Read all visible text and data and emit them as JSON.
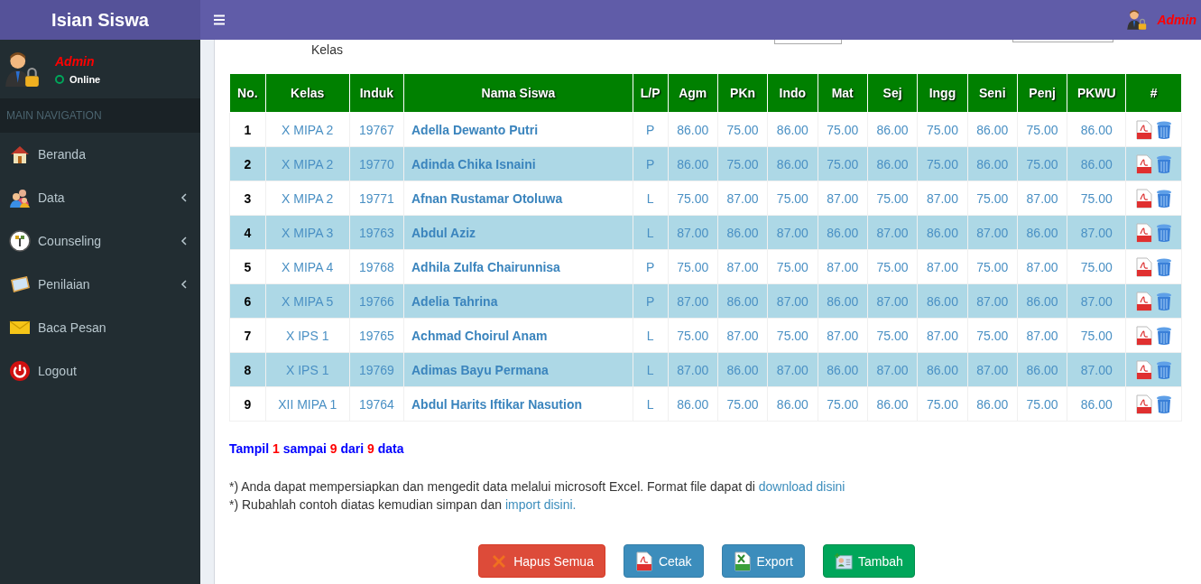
{
  "brand": "Isian Siswa",
  "topbar": {
    "user": "Admin"
  },
  "sidebar": {
    "user": {
      "name": "Admin",
      "status": "Online"
    },
    "header": "MAIN NAVIGATION",
    "items": [
      {
        "label": "Beranda",
        "kind": "house",
        "expandable": false
      },
      {
        "label": "Data",
        "kind": "people",
        "expandable": true
      },
      {
        "label": "Counseling",
        "kind": "emblem",
        "expandable": true
      },
      {
        "label": "Penilaian",
        "kind": "book",
        "expandable": true
      },
      {
        "label": "Baca Pesan",
        "kind": "envelope",
        "expandable": false
      },
      {
        "label": "Logout",
        "kind": "power",
        "expandable": false
      }
    ]
  },
  "filter": {
    "label": "Kelas"
  },
  "table": {
    "columns": [
      "No.",
      "Kelas",
      "Induk",
      "Nama Siswa",
      "L/P",
      "Agm",
      "PKn",
      "Indo",
      "Mat",
      "Sej",
      "Ingg",
      "Seni",
      "Penj",
      "PKWU",
      "#"
    ],
    "rows": [
      [
        "1",
        "X MIPA 2",
        "19767",
        "Adella Dewanto Putri",
        "P",
        "86.00",
        "75.00",
        "86.00",
        "75.00",
        "86.00",
        "75.00",
        "86.00",
        "75.00",
        "86.00"
      ],
      [
        "2",
        "X MIPA 2",
        "19770",
        "Adinda Chika Isnaini",
        "P",
        "86.00",
        "75.00",
        "86.00",
        "75.00",
        "86.00",
        "75.00",
        "86.00",
        "75.00",
        "86.00"
      ],
      [
        "3",
        "X MIPA 2",
        "19771",
        "Afnan Rustamar Otoluwa",
        "L",
        "75.00",
        "87.00",
        "75.00",
        "87.00",
        "75.00",
        "87.00",
        "75.00",
        "87.00",
        "75.00"
      ],
      [
        "4",
        "X MIPA 3",
        "19763",
        "Abdul Aziz",
        "L",
        "87.00",
        "86.00",
        "87.00",
        "86.00",
        "87.00",
        "86.00",
        "87.00",
        "86.00",
        "87.00"
      ],
      [
        "5",
        "X MIPA 4",
        "19768",
        "Adhila Zulfa Chairunnisa",
        "P",
        "75.00",
        "87.00",
        "75.00",
        "87.00",
        "75.00",
        "87.00",
        "75.00",
        "87.00",
        "75.00"
      ],
      [
        "6",
        "X MIPA 5",
        "19766",
        "Adelia Tahrina",
        "P",
        "87.00",
        "86.00",
        "87.00",
        "86.00",
        "87.00",
        "86.00",
        "87.00",
        "86.00",
        "87.00"
      ],
      [
        "7",
        "X IPS 1",
        "19765",
        "Achmad Choirul Anam",
        "L",
        "75.00",
        "87.00",
        "75.00",
        "87.00",
        "75.00",
        "87.00",
        "75.00",
        "87.00",
        "75.00"
      ],
      [
        "8",
        "X IPS 1",
        "19769",
        "Adimas Bayu Permana",
        "L",
        "87.00",
        "86.00",
        "87.00",
        "86.00",
        "87.00",
        "86.00",
        "87.00",
        "86.00",
        "87.00"
      ],
      [
        "9",
        "XII MIPA 1",
        "19764",
        "Abdul Harits Iftikar Nasution",
        "L",
        "86.00",
        "75.00",
        "86.00",
        "75.00",
        "86.00",
        "75.00",
        "86.00",
        "75.00",
        "86.00"
      ]
    ]
  },
  "summary": [
    {
      "text": "Tampil",
      "kind": "label"
    },
    {
      "text": "1",
      "kind": "number"
    },
    {
      "text": "sampai",
      "kind": "label"
    },
    {
      "text": "9",
      "kind": "number"
    },
    {
      "text": "dari",
      "kind": "label"
    },
    {
      "text": "9",
      "kind": "number"
    },
    {
      "text": "data",
      "kind": "label"
    }
  ],
  "notes": [
    {
      "text": "*) Anda dapat mempersiapkan dan mengedit data melalui microsoft Excel. Format file dapat di ",
      "link": "download disini"
    },
    {
      "text": "*) Rubahlah contoh diatas kemudian simpan dan ",
      "link": "import disini."
    }
  ],
  "buttons": [
    {
      "label": "Hapus Semua",
      "kind": "danger"
    },
    {
      "label": "Cetak",
      "kind": "print"
    },
    {
      "label": "Export",
      "kind": "export"
    },
    {
      "label": "Tambah",
      "kind": "add"
    }
  ]
}
